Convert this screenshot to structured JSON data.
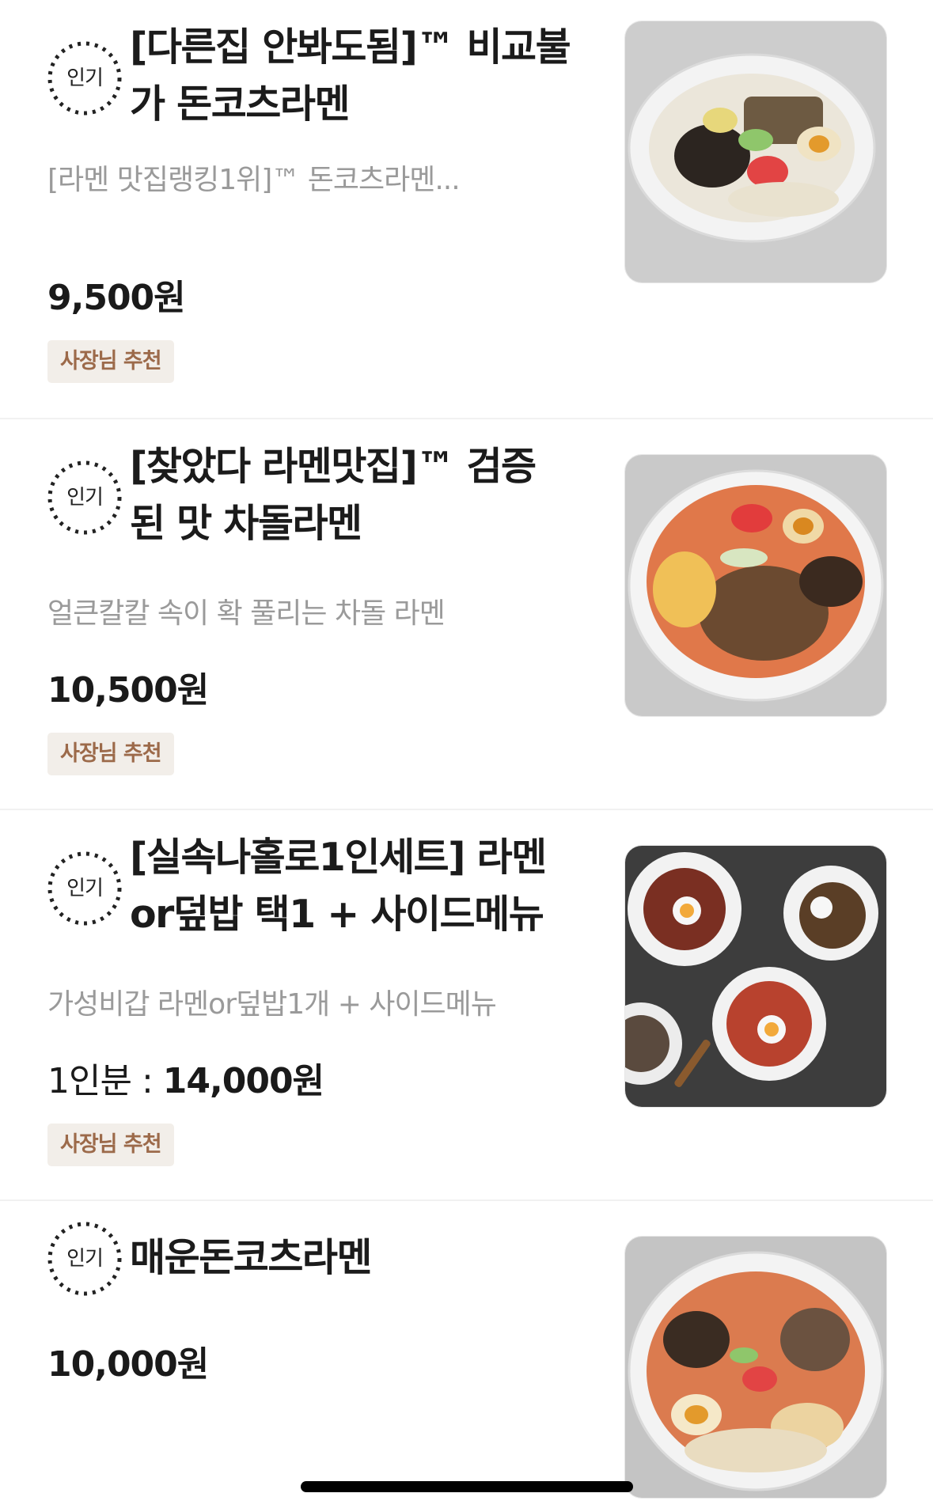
{
  "menu": [
    {
      "badge": "인기",
      "title": "[다른집 안봐도됨]™ 비교불\n가 돈코츠라멘",
      "description": "[라멘 맛집랭킹1위]™ 돈코츠라멘...",
      "price_prefix": "",
      "price": "9,500원",
      "tag": "사장님 추천"
    },
    {
      "badge": "인기",
      "title": "[찾았다 라멘맛집]™  검증\n된 맛 차돌라멘",
      "description": "얼큰칼칼 속이 확 풀리는 차돌 라멘",
      "price_prefix": "",
      "price": "10,500원",
      "tag": "사장님 추천"
    },
    {
      "badge": "인기",
      "title": "[실속나홀로1인세트] 라멘\nor덮밥 택1 + 사이드메뉴",
      "description": "가성비갑 라멘or덮밥1개 + 사이드메뉴",
      "price_prefix": "1인분 : ",
      "price": "14,000원",
      "tag": "사장님 추천"
    },
    {
      "badge": "인기",
      "title": "매운돈코츠라멘",
      "price_prefix": "",
      "price": "10,000원"
    }
  ],
  "colors": {
    "tag_bg": "#f2eee9",
    "tag_text": "#9c6a4a",
    "divider": "#f1f1f1"
  }
}
